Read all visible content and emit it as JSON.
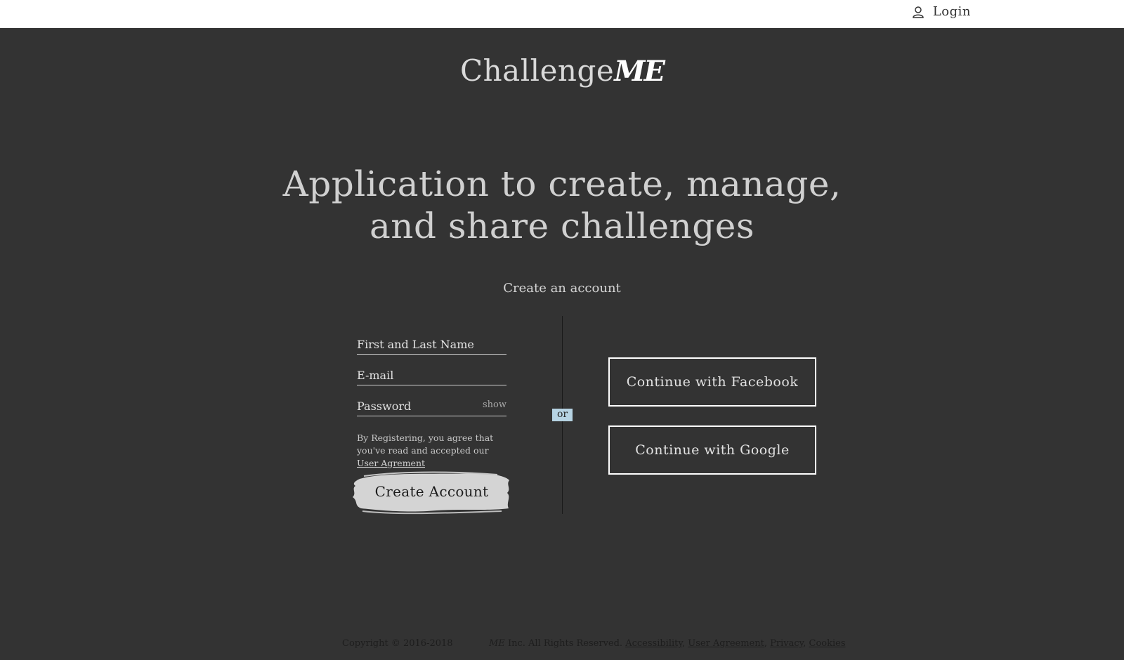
{
  "header": {
    "login_label": "Login",
    "login_icon": "user-icon"
  },
  "logo": {
    "text_main": "Challenge",
    "text_mark": "ME"
  },
  "hero": {
    "line1": "Application to create, manage,",
    "line2": "and share challenges"
  },
  "signup": {
    "title": "Create an account",
    "name_placeholder": "First and Last Name",
    "email_placeholder": "E-mail",
    "password_placeholder": "Password",
    "show_label": "show",
    "terms_text": "By Registering, you agree that you've read and accepted our",
    "terms_link": "User Agrement",
    "create_button": "Create Account"
  },
  "divider": {
    "or_label": "or"
  },
  "social": {
    "facebook_label": "Continue with Facebook",
    "google_label": "Continue with Google"
  },
  "footer": {
    "copyright": "Copyright © 2016-2018",
    "brand_mark": "ME",
    "rights": "Inc. All Rights Reserved.",
    "links": [
      "Accessibility",
      "User Agreement",
      "Privacy",
      "Cookies"
    ]
  },
  "colors": {
    "background": "#333333",
    "topbar": "#ffffff",
    "or_badge": "#b6d3e3",
    "brush": "#d4d4d4"
  }
}
